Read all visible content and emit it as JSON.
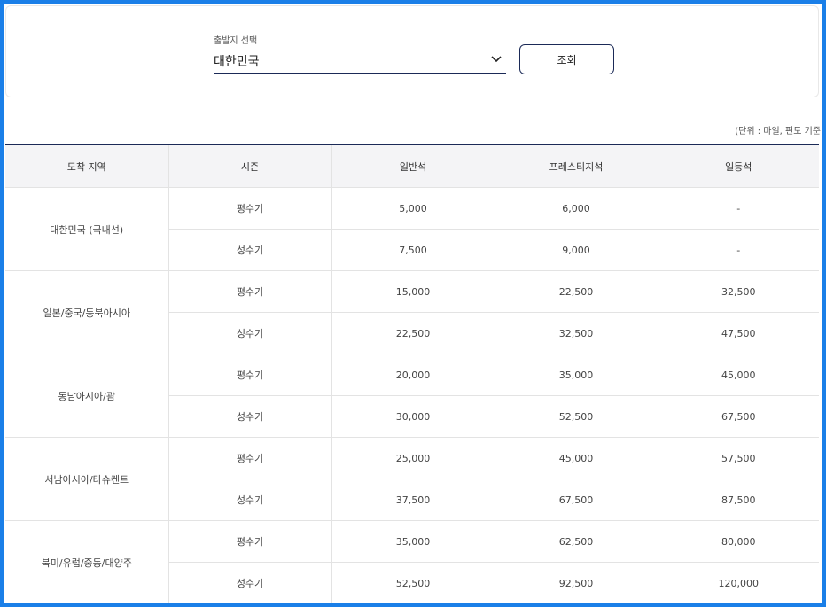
{
  "departure": {
    "label": "출발지 선택",
    "value": "대한민국",
    "search_button": "조회"
  },
  "unit_note": "(단위 : 마일, 편도 기준",
  "table": {
    "headers": [
      "도착 지역",
      "시즌",
      "일반석",
      "프레스티지석",
      "일등석"
    ],
    "regions": [
      {
        "name": "대한민국 (국내선)",
        "rows": [
          {
            "season": "평수기",
            "economy": "5,000",
            "prestige": "6,000",
            "first": "-"
          },
          {
            "season": "성수기",
            "economy": "7,500",
            "prestige": "9,000",
            "first": "-"
          }
        ]
      },
      {
        "name": "일본/중국/동북아시아",
        "rows": [
          {
            "season": "평수기",
            "economy": "15,000",
            "prestige": "22,500",
            "first": "32,500"
          },
          {
            "season": "성수기",
            "economy": "22,500",
            "prestige": "32,500",
            "first": "47,500"
          }
        ]
      },
      {
        "name": "동남아시아/괌",
        "rows": [
          {
            "season": "평수기",
            "economy": "20,000",
            "prestige": "35,000",
            "first": "45,000"
          },
          {
            "season": "성수기",
            "economy": "30,000",
            "prestige": "52,500",
            "first": "67,500"
          }
        ]
      },
      {
        "name": "서남아시아/타슈켄트",
        "rows": [
          {
            "season": "평수기",
            "economy": "25,000",
            "prestige": "45,000",
            "first": "57,500"
          },
          {
            "season": "성수기",
            "economy": "37,500",
            "prestige": "67,500",
            "first": "87,500"
          }
        ]
      },
      {
        "name": "북미/유럽/중동/대양주",
        "rows": [
          {
            "season": "평수기",
            "economy": "35,000",
            "prestige": "62,500",
            "first": "80,000"
          },
          {
            "season": "성수기",
            "economy": "52,500",
            "prestige": "92,500",
            "first": "120,000"
          }
        ]
      }
    ]
  }
}
